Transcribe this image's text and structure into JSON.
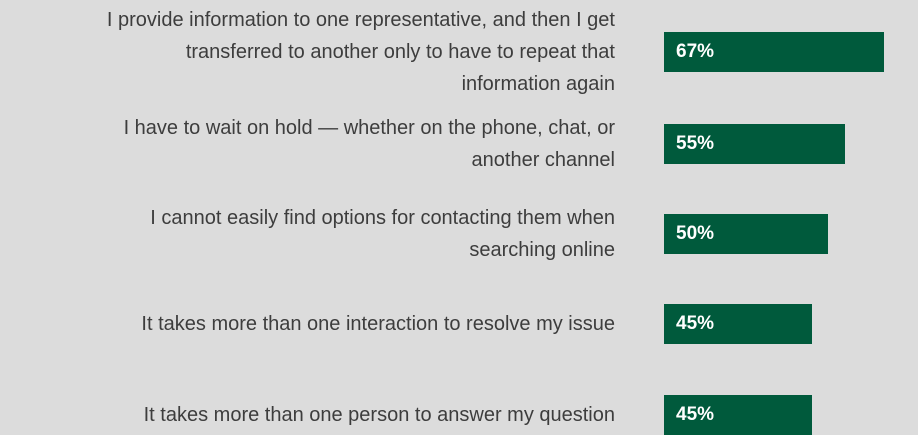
{
  "chart_data": {
    "type": "bar",
    "orientation": "horizontal",
    "categories": [
      "I provide information to one representative, and then I get transferred to another only to have to repeat that information again",
      "I have to wait on hold — whether on the phone, chat, or another channel",
      "I cannot easily find options for contacting them when searching online",
      "It takes more than one interaction to resolve my issue",
      "It takes more than one person to answer my question"
    ],
    "label_lines": [
      [
        "I provide information to one representative, and then I get",
        "transferred to another only to have to repeat that",
        "information again"
      ],
      [
        "I have to wait on hold — whether on the phone, chat, or",
        "another channel"
      ],
      [
        "I cannot easily find options for contacting them when",
        "searching online"
      ],
      [
        "It takes more than one interaction to resolve my issue"
      ],
      [
        "It takes more than one person to answer my question"
      ]
    ],
    "values": [
      67,
      55,
      50,
      45,
      45
    ],
    "data_labels": [
      "67%",
      "55%",
      "50%",
      "45%",
      "45%"
    ],
    "unit": "%",
    "bar_color": "#005a3c",
    "grid": false,
    "legend": "none"
  },
  "colors": {
    "background": "#dcdcdc",
    "bar": "#005a3c",
    "label_text": "#3d3d3d",
    "value_text": "#ffffff"
  }
}
